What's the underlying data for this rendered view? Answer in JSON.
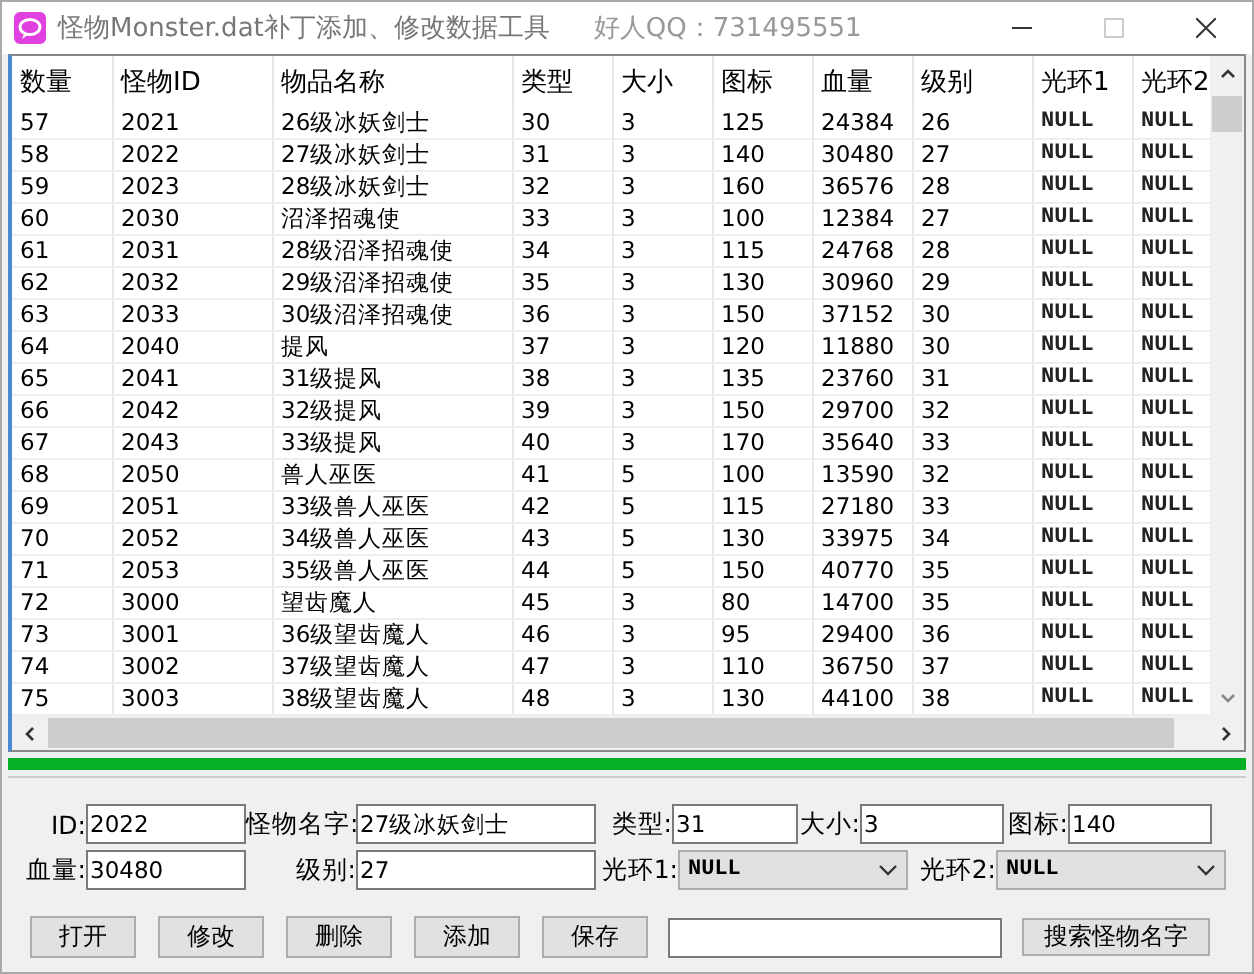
{
  "window": {
    "title": "怪物Monster.dat补丁添加、修改数据工具",
    "subtitle": "好人QQ：731495551"
  },
  "table": {
    "columns": [
      "数量",
      "怪物ID",
      "物品名称",
      "类型",
      "大小",
      "图标",
      "血量",
      "级别",
      "光环1",
      "光环2"
    ],
    "rows": [
      [
        "57",
        "2021",
        "26级冰妖剑士",
        "30",
        "3",
        "125",
        "24384",
        "26",
        "NULL",
        "NULL"
      ],
      [
        "58",
        "2022",
        "27级冰妖剑士",
        "31",
        "3",
        "140",
        "30480",
        "27",
        "NULL",
        "NULL"
      ],
      [
        "59",
        "2023",
        "28级冰妖剑士",
        "32",
        "3",
        "160",
        "36576",
        "28",
        "NULL",
        "NULL"
      ],
      [
        "60",
        "2030",
        "沼泽招魂使",
        "33",
        "3",
        "100",
        "12384",
        "27",
        "NULL",
        "NULL"
      ],
      [
        "61",
        "2031",
        "28级沼泽招魂使",
        "34",
        "3",
        "115",
        "24768",
        "28",
        "NULL",
        "NULL"
      ],
      [
        "62",
        "2032",
        "29级沼泽招魂使",
        "35",
        "3",
        "130",
        "30960",
        "29",
        "NULL",
        "NULL"
      ],
      [
        "63",
        "2033",
        "30级沼泽招魂使",
        "36",
        "3",
        "150",
        "37152",
        "30",
        "NULL",
        "NULL"
      ],
      [
        "64",
        "2040",
        "提风",
        "37",
        "3",
        "120",
        "11880",
        "30",
        "NULL",
        "NULL"
      ],
      [
        "65",
        "2041",
        "31级提风",
        "38",
        "3",
        "135",
        "23760",
        "31",
        "NULL",
        "NULL"
      ],
      [
        "66",
        "2042",
        "32级提风",
        "39",
        "3",
        "150",
        "29700",
        "32",
        "NULL",
        "NULL"
      ],
      [
        "67",
        "2043",
        "33级提风",
        "40",
        "3",
        "170",
        "35640",
        "33",
        "NULL",
        "NULL"
      ],
      [
        "68",
        "2050",
        "兽人巫医",
        "41",
        "5",
        "100",
        "13590",
        "32",
        "NULL",
        "NULL"
      ],
      [
        "69",
        "2051",
        "33级兽人巫医",
        "42",
        "5",
        "115",
        "27180",
        "33",
        "NULL",
        "NULL"
      ],
      [
        "70",
        "2052",
        "34级兽人巫医",
        "43",
        "5",
        "130",
        "33975",
        "34",
        "NULL",
        "NULL"
      ],
      [
        "71",
        "2053",
        "35级兽人巫医",
        "44",
        "5",
        "150",
        "40770",
        "35",
        "NULL",
        "NULL"
      ],
      [
        "72",
        "3000",
        "望齿魔人",
        "45",
        "3",
        "80",
        "14700",
        "35",
        "NULL",
        "NULL"
      ],
      [
        "73",
        "3001",
        "36级望齿魔人",
        "46",
        "3",
        "95",
        "29400",
        "36",
        "NULL",
        "NULL"
      ],
      [
        "74",
        "3002",
        "37级望齿魔人",
        "47",
        "3",
        "110",
        "36750",
        "37",
        "NULL",
        "NULL"
      ],
      [
        "75",
        "3003",
        "38级望齿魔人",
        "48",
        "3",
        "130",
        "44100",
        "38",
        "NULL",
        "NULL"
      ]
    ]
  },
  "progress": {
    "level": 1
  },
  "form": {
    "rows": [
      [
        {
          "label": "ID:",
          "value": "2022",
          "kind": "text"
        },
        {
          "label": "怪物名字:",
          "value": "27级冰妖剑士",
          "kind": "text"
        },
        {
          "label": "类型:",
          "value": "31",
          "kind": "text"
        },
        {
          "label": "大小:",
          "value": "3",
          "kind": "text"
        },
        {
          "label": "图标:",
          "value": "140",
          "kind": "text"
        }
      ],
      [
        {
          "label": "血量:",
          "value": "30480",
          "kind": "text"
        },
        {
          "label": "级别:",
          "value": "27",
          "kind": "text"
        },
        {
          "label": "光环1:",
          "value": "NULL",
          "kind": "select"
        },
        {
          "label": "光环2:",
          "value": "NULL",
          "kind": "select"
        }
      ]
    ]
  },
  "buttons": [
    "打开",
    "修改",
    "删除",
    "添加",
    "保存"
  ],
  "search_button": "搜索怪物名字"
}
